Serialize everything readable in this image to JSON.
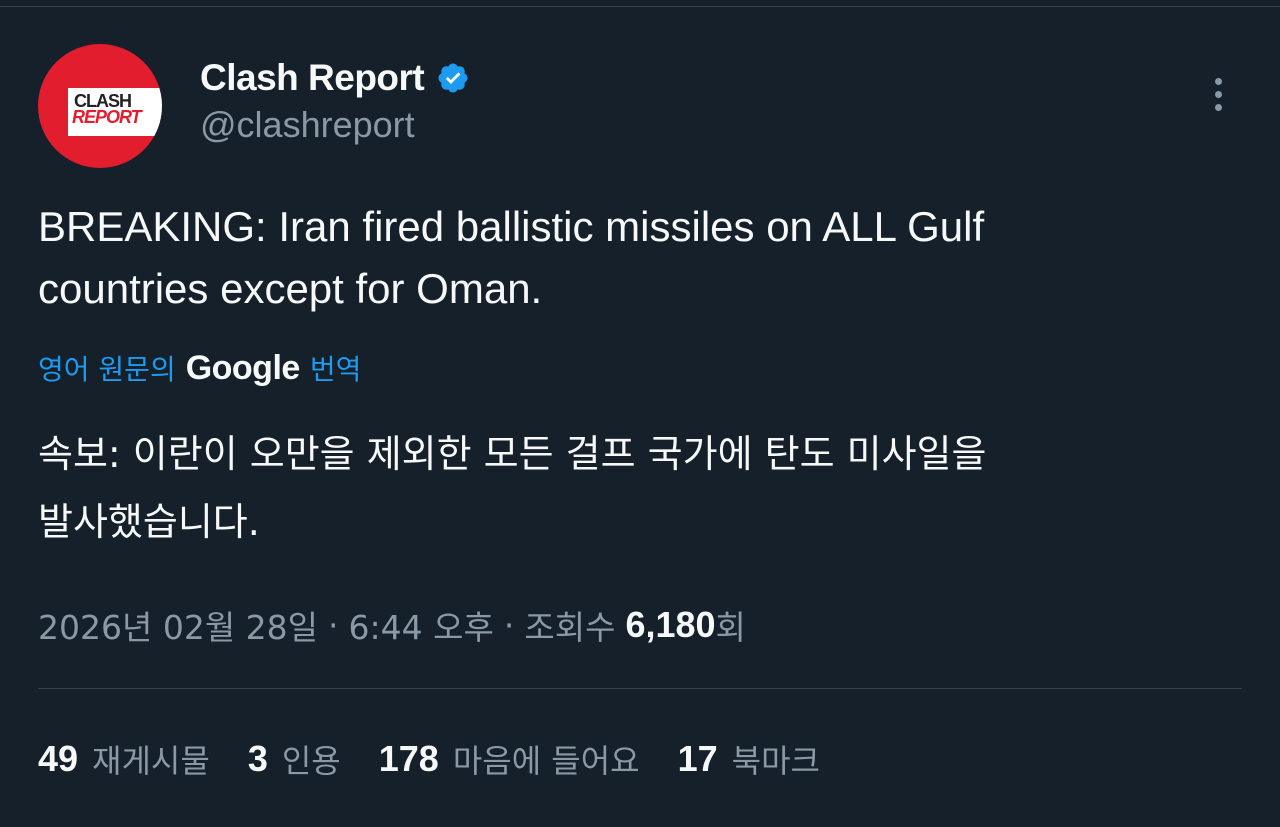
{
  "author": {
    "display_name": "Clash Report",
    "handle": "@clashreport",
    "verified": true,
    "avatar": {
      "line1": "CLASH",
      "line2": "REPORT",
      "bg_color": "#e11d2e"
    }
  },
  "tweet": {
    "text": "BREAKING: Iran fired ballistic missiles on ALL Gulf\ncountries except for Oman."
  },
  "translation": {
    "prefix": "영어 원문의",
    "brand": "Google",
    "suffix": "번역",
    "text": "속보: 이란이 오만을 제외한 모든 걸프 국가에 탄도 미사일을\n발사했습니다."
  },
  "meta": {
    "date": "2026년 02월 28일",
    "separator": "·",
    "time": "6:44 오후",
    "views_label": "조회수",
    "views_count": "6,180",
    "views_suffix": "회"
  },
  "stats": [
    {
      "count": "49",
      "label": "재게시물"
    },
    {
      "count": "3",
      "label": "인용"
    },
    {
      "count": "178",
      "label": "마음에 들어요"
    },
    {
      "count": "17",
      "label": "북마크"
    }
  ],
  "colors": {
    "background": "#15202b",
    "primary_text": "#f7f9f9",
    "secondary_text": "#8b98a5",
    "accent": "#1d9bf0",
    "divider": "#38444d"
  },
  "icons": {
    "verified": "verified-badge-icon",
    "more": "more-options-icon"
  }
}
